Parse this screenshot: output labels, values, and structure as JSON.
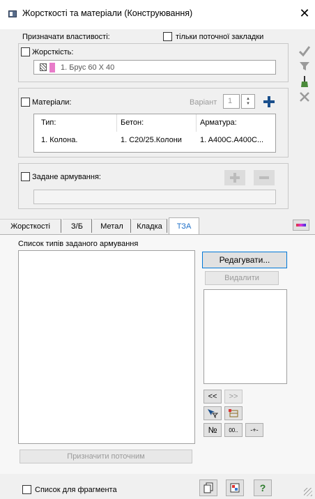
{
  "window": {
    "title": "Жорсткості та матеріали (Конструювання)",
    "close_glyph": "✕"
  },
  "assign": {
    "label": "Призначати властивості:",
    "only_current_tab": "тільки поточної закладки"
  },
  "stiffness": {
    "label": "Жорсткість:",
    "value": "1. Брус 60 X 40",
    "swatch_color": "#e87bc9"
  },
  "materials": {
    "label": "Матеріали:",
    "variant_label": "Варіант",
    "variant_value": "1",
    "columns": [
      "Тип:",
      "Бетон:",
      "Арматура:"
    ],
    "rows": [
      [
        "1. Колона.",
        "1. С20/25.Колони",
        "1. A400C.A400C..."
      ]
    ]
  },
  "reinforcement": {
    "label": "Задане армування:"
  },
  "tabs": [
    "Жорсткості",
    "З/Б",
    "Метал",
    "Кладка",
    "ТЗА"
  ],
  "active_tab": 4,
  "tza": {
    "list_title": "Список типів заданого армування",
    "edit_button": "Редагувати...",
    "delete_button": "Видалити",
    "move_left": "<<",
    "move_right": ">>",
    "number_button": "№",
    "format_button": "00..",
    "sign_button": "-+-",
    "assign_current": "Призначити поточним"
  },
  "footer": {
    "fragment_list": "Список для фрагмента",
    "help_glyph": "?"
  },
  "colors": {
    "accent_plus": "#1a4f8c",
    "check_green": "#4a8a3a",
    "tab_active_text": "#1e6fc8"
  }
}
